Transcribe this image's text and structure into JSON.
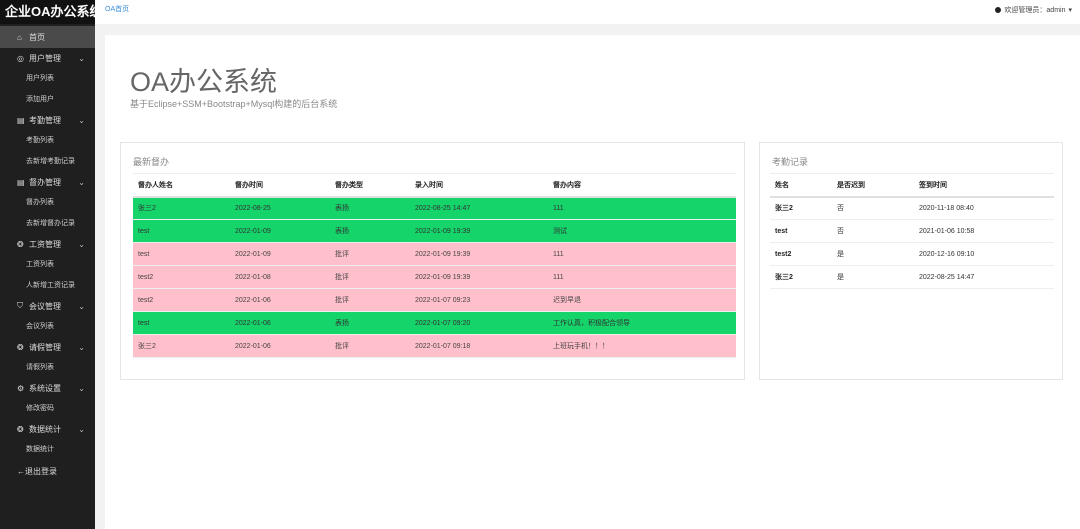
{
  "app": {
    "brand": "企业OA办公系统"
  },
  "topbar": {
    "breadcrumb": "OA首页",
    "user": "欢迎管理员：admin"
  },
  "sidebar": {
    "home": "首页",
    "groups": [
      {
        "label": "用户管理",
        "icon": "user-icon",
        "items": [
          "用户列表",
          "添加用户"
        ]
      },
      {
        "label": "考勤管理",
        "icon": "document-icon",
        "items": [
          "考勤列表",
          "去新增考勤记录"
        ]
      },
      {
        "label": "督办管理",
        "icon": "document-icon",
        "items": [
          "督办列表",
          "去新增督办记录"
        ]
      },
      {
        "label": "工资管理",
        "icon": "gear-icon",
        "items": [
          "工资列表",
          "人新增工资记录"
        ]
      },
      {
        "label": "会议管理",
        "icon": "shield-icon",
        "items": [
          "会议列表"
        ]
      },
      {
        "label": "请假管理",
        "icon": "gear-icon",
        "items": [
          "请假列表"
        ]
      },
      {
        "label": "系统设置",
        "icon": "gear-icon",
        "items": [
          "修改密码"
        ]
      },
      {
        "label": "数据统计",
        "icon": "gear-icon",
        "items": [
          "数据统计"
        ]
      }
    ],
    "logout": "退出登录"
  },
  "main": {
    "title": "OA办公系统",
    "subtitle": "基于Eclipse+SSM+Bootstrap+Mysql构建的后台系统"
  },
  "supervision": {
    "title": "最新督办",
    "headers": [
      "督办人姓名",
      "督办时间",
      "督办类型",
      "录入时间",
      "督办内容"
    ],
    "rows": [
      {
        "status": "green",
        "cells": [
          "张三2",
          "2022-08-25",
          "表扬",
          "2022-08-25 14:47",
          "111"
        ]
      },
      {
        "status": "green",
        "cells": [
          "test",
          "2022-01-09",
          "表扬",
          "2022-01-09 19:39",
          "测试"
        ]
      },
      {
        "status": "pink",
        "cells": [
          "test",
          "2022-01-09",
          "批评",
          "2022-01-09 19:39",
          "111"
        ]
      },
      {
        "status": "pink",
        "cells": [
          "test2",
          "2022-01-08",
          "批评",
          "2022-01-09 19:39",
          "111"
        ]
      },
      {
        "status": "pink",
        "cells": [
          "test2",
          "2022-01-06",
          "批评",
          "2022-01-07 09:23",
          "迟到早退"
        ]
      },
      {
        "status": "green",
        "cells": [
          "test",
          "2022-01-06",
          "表扬",
          "2022-01-07 09:20",
          "工作认真，积极配合领导"
        ]
      },
      {
        "status": "pink",
        "cells": [
          "张三2",
          "2022-01-06",
          "批评",
          "2022-01-07 09:18",
          "上班玩手机！！！"
        ]
      }
    ]
  },
  "attendance": {
    "title": "考勤记录",
    "headers": [
      "姓名",
      "是否迟到",
      "签到时间"
    ],
    "rows": [
      [
        "张三2",
        "否",
        "2020-11-18 08:40"
      ],
      [
        "test",
        "否",
        "2021-01-06 10:58"
      ],
      [
        "test2",
        "是",
        "2020-12-16 09:10"
      ],
      [
        "张三2",
        "是",
        "2022-08-25 14:47"
      ]
    ]
  },
  "colors": {
    "praise_row": "#14d46a",
    "criticism_row": "#ffc0cb",
    "sidebar_bg": "#1f1f1f",
    "link": "#3a8fd8"
  }
}
